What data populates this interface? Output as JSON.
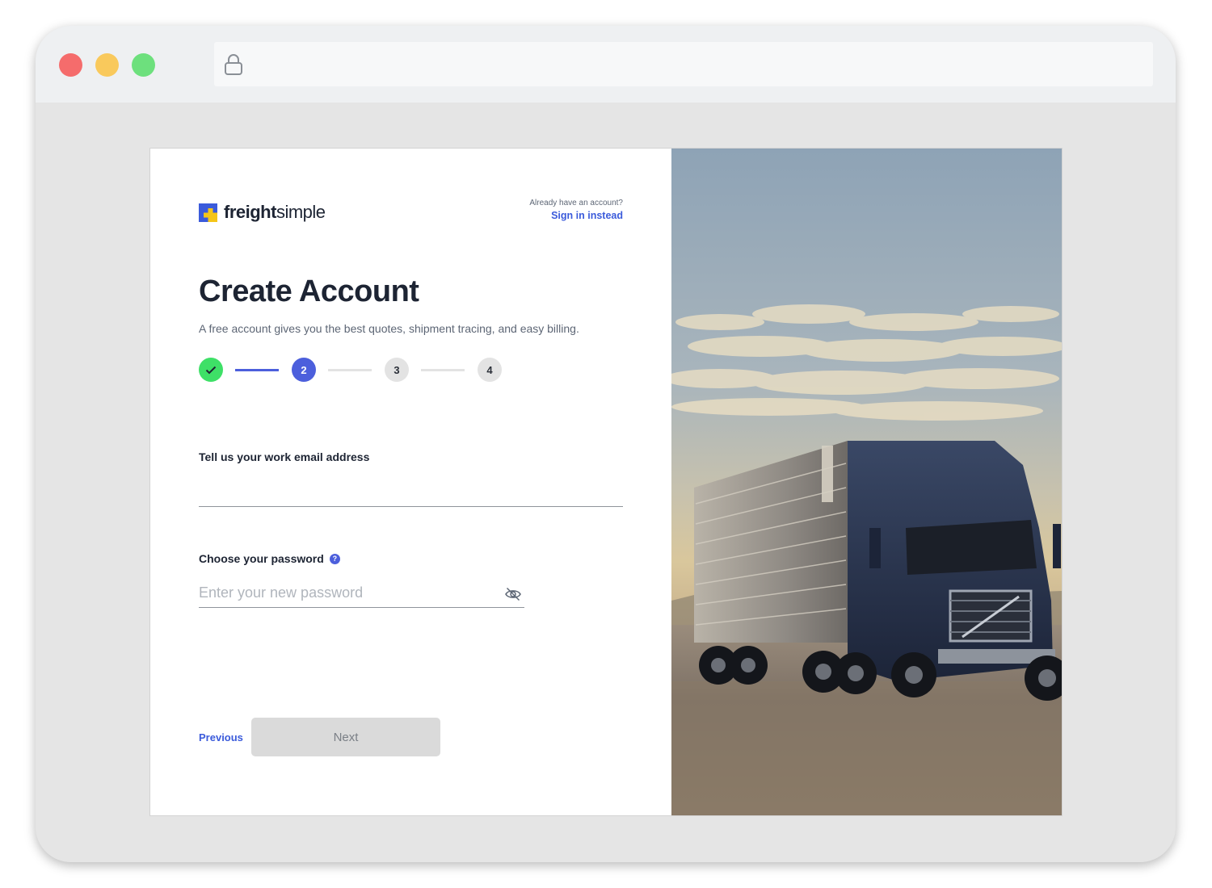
{
  "brand": {
    "name_bold": "freight",
    "name_regular": "simple",
    "colors": {
      "blue": "#3b5bdb",
      "yellow": "#f5c518"
    }
  },
  "header": {
    "signin_prompt": "Already have an account?",
    "signin_link": "Sign in instead"
  },
  "main": {
    "title": "Create Account",
    "subtitle": "A free account gives you the best quotes, shipment tracing, and easy billing."
  },
  "stepper": {
    "current_step": 2,
    "steps": [
      {
        "label": "",
        "status": "completed",
        "icon": "check-icon"
      },
      {
        "label": "2",
        "status": "active"
      },
      {
        "label": "3",
        "status": "pending"
      },
      {
        "label": "4",
        "status": "pending"
      }
    ]
  },
  "form": {
    "email_label": "Tell us your work email address",
    "email_value": "",
    "password_label": "Choose your password",
    "password_help_icon": "?",
    "password_placeholder": "Enter your new password",
    "password_visibility_icon": "eye-off-icon"
  },
  "actions": {
    "previous_label": "Previous",
    "next_label": "Next"
  },
  "browser": {
    "lock_icon": "lock-icon"
  },
  "colors": {
    "accent": "#4c5fdc",
    "success": "#3ee067",
    "pending": "#e3e3e3",
    "disabled_button": "#dadada"
  }
}
